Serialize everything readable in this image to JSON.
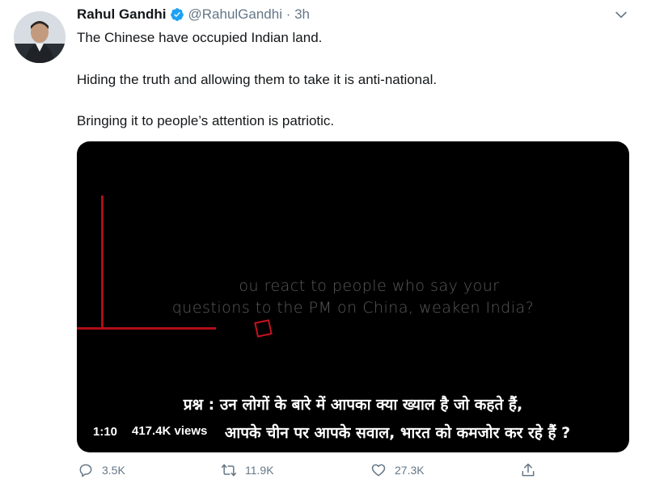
{
  "tweet": {
    "author_name": "Rahul Gandhi",
    "handle_time": "@RahulGandhi · 3h",
    "lines": [
      "The Chinese have occupied Indian land.",
      "Hiding the truth and allowing them to take it is anti-national.",
      "Bringing it to people’s attention is patriotic."
    ]
  },
  "video": {
    "overlay_line1": "ou react to people who say your",
    "overlay_line2": "questions to the PM on China, weaken India?",
    "subtitle_line1": "प्रश्न : उन लोगों के बारे में आपका क्या ख्याल है जो कहते हैं,",
    "subtitle_line2": "आपके चीन पर आपके सवाल, भारत को कमजोर कर रहे हैं ?",
    "time": "1:10",
    "views": "417.4K views"
  },
  "actions": {
    "replies": "3.5K",
    "retweets": "11.9K",
    "likes": "27.3K"
  },
  "colors": {
    "verified": "#1da1f2",
    "accent_red": "#b00d16",
    "muted": "#657786"
  }
}
